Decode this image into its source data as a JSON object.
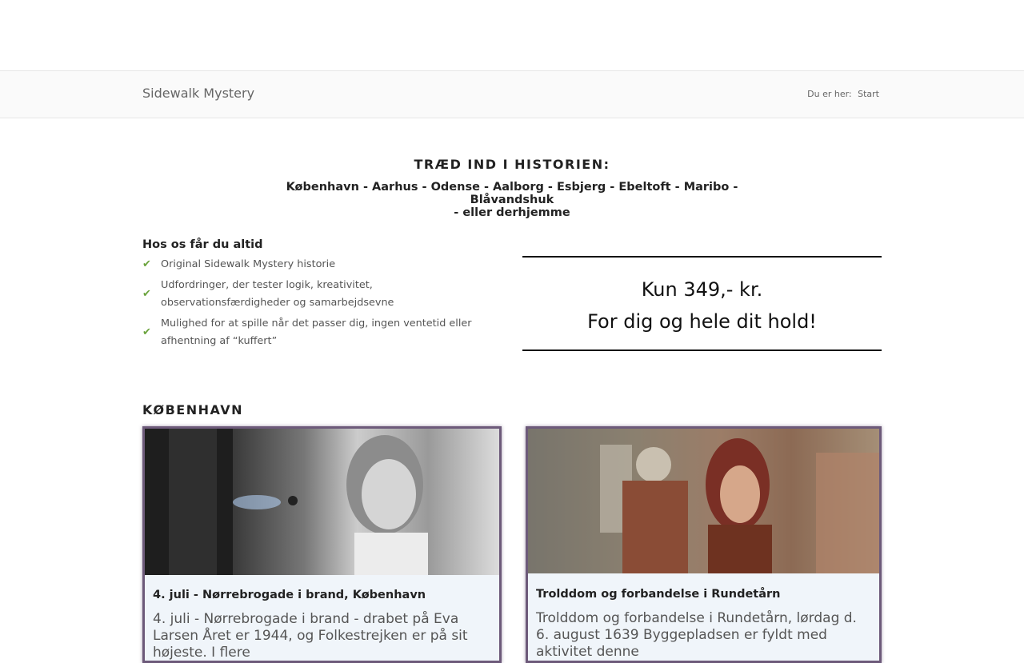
{
  "header": {
    "site_title": "Sidewalk Mystery",
    "breadcrumb_prefix": "Du er her:",
    "breadcrumb_current": "Start"
  },
  "hero": {
    "heading": "TRÆD IND I HISTORIEN:",
    "cities_line1": "København - Aarhus - Odense - Aalborg - Esbjerg - Ebeltoft - Maribo - Blåvandshuk",
    "cities_line2": "- eller derhjemme"
  },
  "features": {
    "title": "Hos os får du altid",
    "items": [
      "Original Sidewalk Mystery historie",
      "Udfordringer, der tester logik, kreativitet, observationsfærdigheder og samarbejdsevne",
      "Mulighed for at spille når det passer dig, ingen ventetid eller afhentning af “kuffert”"
    ],
    "icon": "check-icon",
    "icon_color": "#6aa33c"
  },
  "price": {
    "line1": "Kun 349,- kr.",
    "line2": "For dig og hele dit hold!"
  },
  "section": {
    "title": "KØBENHAVN"
  },
  "cards": [
    {
      "title": "4. juli - Nørrebrogade i brand, København",
      "text": "4. juli - Nørrebrogade i brand - drabet på Eva Larsen Året er 1944, og Folkestrejken er på sit højeste. I flere"
    },
    {
      "title": "Trolddom og forbandelse i Rundetårn",
      "text": "Trolddom og forbandelse i Rundetårn, lørdag d. 6. august 1639 Byggepladsen er fyldt med aktivitet denne"
    }
  ],
  "colors": {
    "card_border": "#6d5a7a",
    "card_background": "#f0f5fa"
  }
}
